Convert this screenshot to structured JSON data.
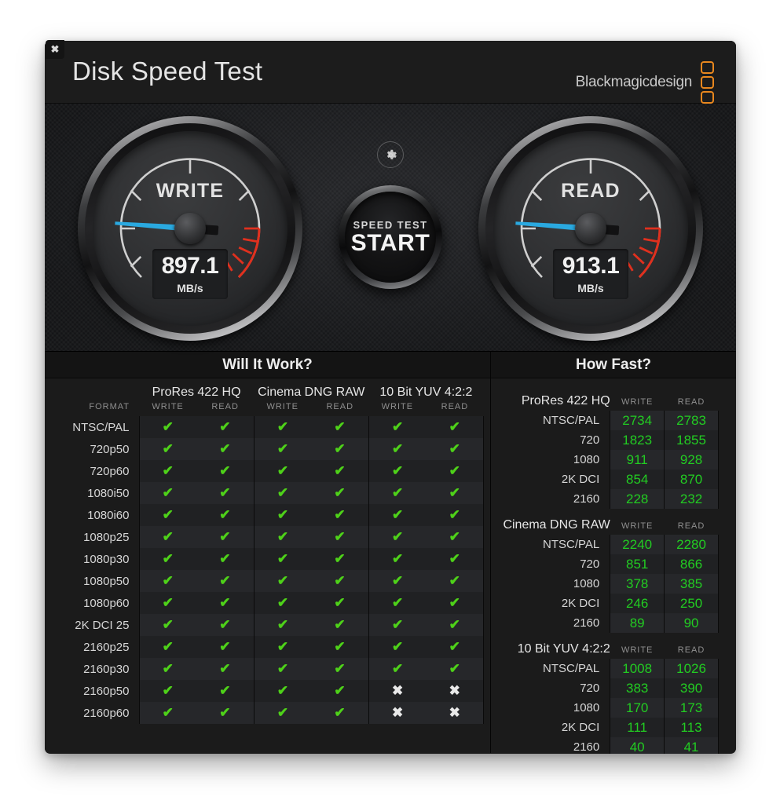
{
  "window": {
    "title": "Disk Speed Test",
    "close_icon": "close-icon",
    "brand_text": "Blackmagicdesign",
    "brand_accent": "#e8871e"
  },
  "gauges": {
    "write": {
      "label": "WRITE",
      "value": "897.1",
      "unit": "MB/s",
      "needle_color": "#2aa9e0"
    },
    "read": {
      "label": "READ",
      "value": "913.1",
      "unit": "MB/s",
      "needle_color": "#2aa9e0"
    }
  },
  "controls": {
    "gear_icon": "gear-icon",
    "start_sub": "SPEED TEST",
    "start_main": "START"
  },
  "will_it_work": {
    "title": "Will It Work?",
    "format_header": "FORMAT",
    "groups": [
      "ProRes 422 HQ",
      "Cinema DNG RAW",
      "10 Bit YUV 4:2:2"
    ],
    "sub_headers": [
      "WRITE",
      "READ"
    ],
    "ok_glyph": "✔",
    "fail_glyph": "✖",
    "rows": [
      {
        "format": "NTSC/PAL",
        "cells": [
          true,
          true,
          true,
          true,
          true,
          true
        ]
      },
      {
        "format": "720p50",
        "cells": [
          true,
          true,
          true,
          true,
          true,
          true
        ]
      },
      {
        "format": "720p60",
        "cells": [
          true,
          true,
          true,
          true,
          true,
          true
        ]
      },
      {
        "format": "1080i50",
        "cells": [
          true,
          true,
          true,
          true,
          true,
          true
        ]
      },
      {
        "format": "1080i60",
        "cells": [
          true,
          true,
          true,
          true,
          true,
          true
        ]
      },
      {
        "format": "1080p25",
        "cells": [
          true,
          true,
          true,
          true,
          true,
          true
        ]
      },
      {
        "format": "1080p30",
        "cells": [
          true,
          true,
          true,
          true,
          true,
          true
        ]
      },
      {
        "format": "1080p50",
        "cells": [
          true,
          true,
          true,
          true,
          true,
          true
        ]
      },
      {
        "format": "1080p60",
        "cells": [
          true,
          true,
          true,
          true,
          true,
          true
        ]
      },
      {
        "format": "2K DCI 25",
        "cells": [
          true,
          true,
          true,
          true,
          true,
          true
        ]
      },
      {
        "format": "2160p25",
        "cells": [
          true,
          true,
          true,
          true,
          true,
          true
        ]
      },
      {
        "format": "2160p30",
        "cells": [
          true,
          true,
          true,
          true,
          true,
          true
        ]
      },
      {
        "format": "2160p50",
        "cells": [
          true,
          true,
          true,
          true,
          false,
          false
        ]
      },
      {
        "format": "2160p60",
        "cells": [
          true,
          true,
          true,
          true,
          false,
          false
        ]
      }
    ]
  },
  "how_fast": {
    "title": "How Fast?",
    "sub_headers": [
      "WRITE",
      "READ"
    ],
    "sections": [
      {
        "name": "ProRes 422 HQ",
        "rows": [
          {
            "label": "NTSC/PAL",
            "write": "2734",
            "read": "2783"
          },
          {
            "label": "720",
            "write": "1823",
            "read": "1855"
          },
          {
            "label": "1080",
            "write": "911",
            "read": "928"
          },
          {
            "label": "2K DCI",
            "write": "854",
            "read": "870"
          },
          {
            "label": "2160",
            "write": "228",
            "read": "232"
          }
        ]
      },
      {
        "name": "Cinema DNG RAW",
        "rows": [
          {
            "label": "NTSC/PAL",
            "write": "2240",
            "read": "2280"
          },
          {
            "label": "720",
            "write": "851",
            "read": "866"
          },
          {
            "label": "1080",
            "write": "378",
            "read": "385"
          },
          {
            "label": "2K DCI",
            "write": "246",
            "read": "250"
          },
          {
            "label": "2160",
            "write": "89",
            "read": "90"
          }
        ]
      },
      {
        "name": "10 Bit YUV 4:2:2",
        "rows": [
          {
            "label": "NTSC/PAL",
            "write": "1008",
            "read": "1026"
          },
          {
            "label": "720",
            "write": "383",
            "read": "390"
          },
          {
            "label": "1080",
            "write": "170",
            "read": "173"
          },
          {
            "label": "2K DCI",
            "write": "111",
            "read": "113"
          },
          {
            "label": "2160",
            "write": "40",
            "read": "41"
          }
        ]
      }
    ]
  }
}
